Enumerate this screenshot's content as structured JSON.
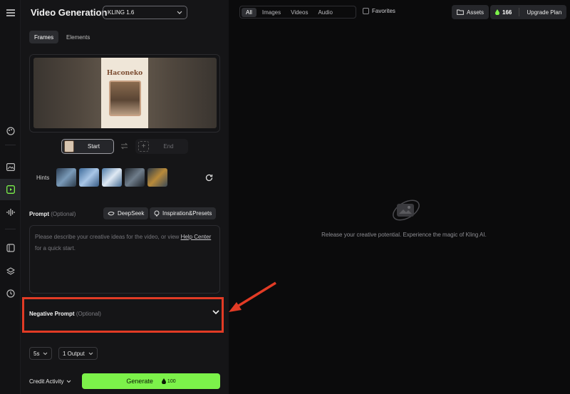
{
  "header": {
    "title": "Video Generation",
    "model": "KLING 1.6"
  },
  "mode_tabs": [
    "Frames",
    "Elements"
  ],
  "frames": {
    "poster_text": "Haconeko",
    "start_label": "Start",
    "end_label": "End"
  },
  "hints": {
    "label": "Hints",
    "thumbs": [
      {
        "color": "#4a6a8a"
      },
      {
        "color": "#5a86b0"
      },
      {
        "color": "#6f93b5"
      },
      {
        "color": "#3f4a55"
      },
      {
        "color": "#6a5a3a"
      }
    ]
  },
  "prompt": {
    "label": "Prompt",
    "optional": "(Optional)",
    "deepseek_label": "DeepSeek",
    "presets_label": "Inspiration&Presets",
    "placeholder_before": "Please describe your creative ideas for the video, or view",
    "help_link": "Help Center",
    "placeholder_after": "for a quick start."
  },
  "negative_prompt": {
    "label": "Negative Prompt",
    "optional": "(Optional)"
  },
  "settings": {
    "duration": "5s",
    "outputs": "1 Output"
  },
  "footer": {
    "credit_activity": "Credit Activity",
    "generate_label": "Generate",
    "generate_cost": "100"
  },
  "top_bar": {
    "filters": [
      "All",
      "Images",
      "Videos",
      "Audio"
    ],
    "favorites": "Favorites",
    "assets": "Assets",
    "credits": "166",
    "upgrade": "Upgrade Plan"
  },
  "empty_state": {
    "message": "Release your creative potential. Experience the magic of Kling AI."
  },
  "colors": {
    "accent_green": "#7cf24a",
    "highlight_red": "#e23b25"
  },
  "icons": {
    "rail": [
      "menu-icon",
      "palette-icon",
      "image-icon",
      "video-icon",
      "audio-icon",
      "box-icon",
      "layers-icon",
      "history-icon"
    ]
  }
}
